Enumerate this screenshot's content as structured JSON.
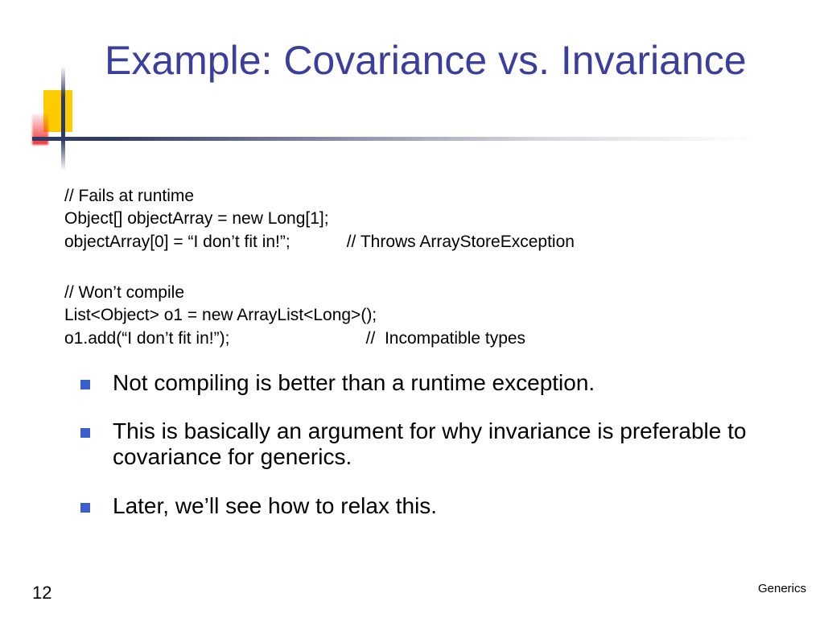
{
  "title": "Example: Covariance vs. Invariance",
  "code1": "// Fails at runtime\nObject[] objectArray = new Long[1];\nobjectArray[0] = “I don’t fit in!”;            // Throws ArrayStoreException",
  "code2": "// Won’t compile\nList<Object> o1 = new ArrayList<Long>();\no1.add(“I don’t fit in!”);                             //  Incompatible types",
  "bullets": [
    "Not compiling is better than a runtime exception.",
    "This is basically an argument for why invariance is preferable to covariance for generics.",
    "Later, we’ll see how to relax this."
  ],
  "page_number": "12",
  "footer": "Generics"
}
